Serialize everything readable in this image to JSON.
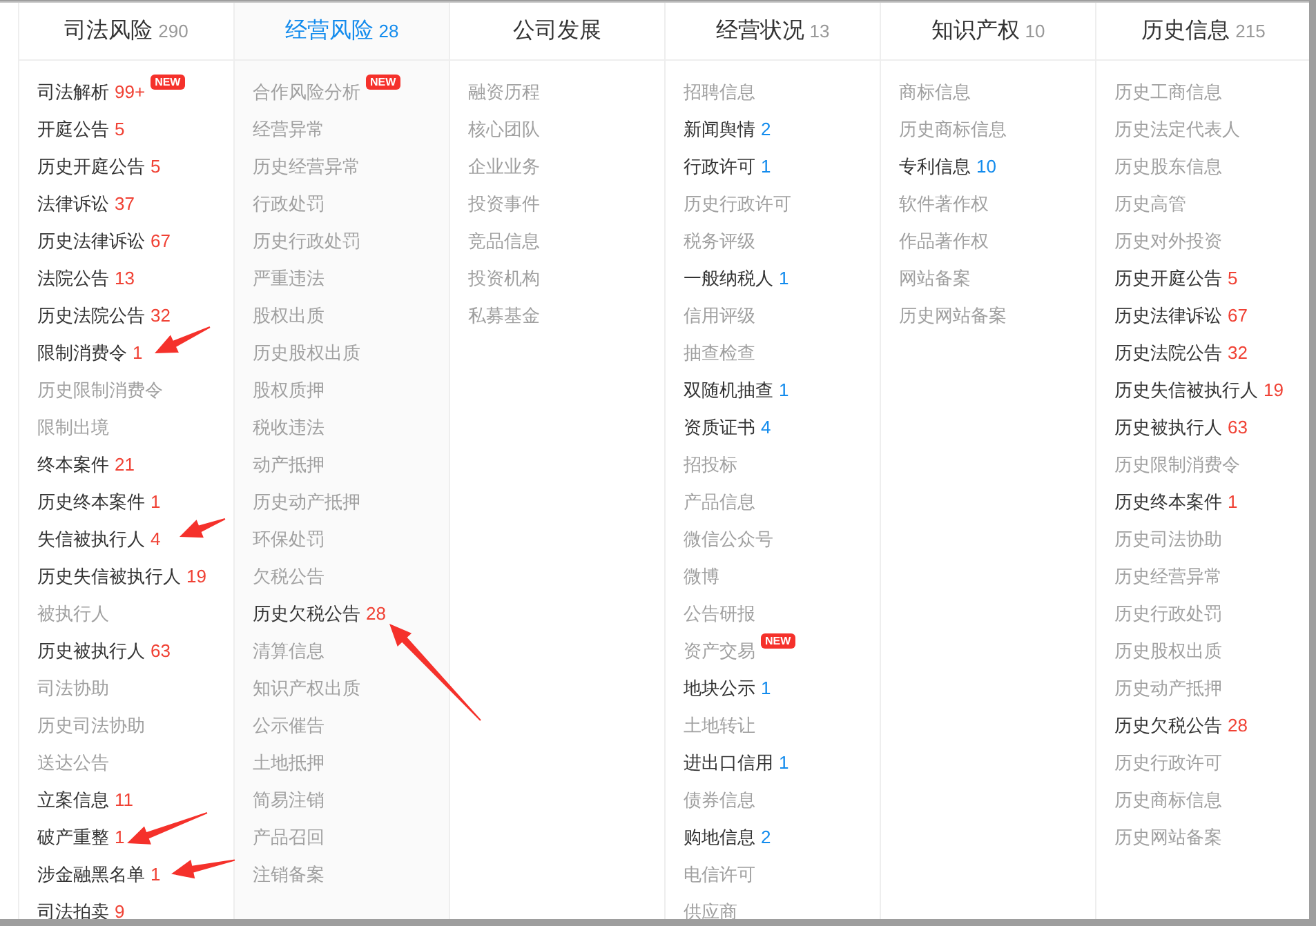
{
  "columns": [
    {
      "title": "司法风险",
      "count": "290",
      "selected": false,
      "items": [
        {
          "label": "司法解析",
          "count": "99+",
          "color": "#f04134",
          "badge": "NEW",
          "disabled": false
        },
        {
          "label": "开庭公告",
          "count": "5",
          "color": "#f04134",
          "disabled": false
        },
        {
          "label": "历史开庭公告",
          "count": "5",
          "color": "#f04134",
          "disabled": false
        },
        {
          "label": "法律诉讼",
          "count": "37",
          "color": "#f04134",
          "disabled": false
        },
        {
          "label": "历史法律诉讼",
          "count": "67",
          "color": "#f04134",
          "disabled": false
        },
        {
          "label": "法院公告",
          "count": "13",
          "color": "#f04134",
          "disabled": false
        },
        {
          "label": "历史法院公告",
          "count": "32",
          "color": "#f04134",
          "disabled": false
        },
        {
          "label": "限制消费令",
          "count": "1",
          "color": "#f04134",
          "disabled": false
        },
        {
          "label": "历史限制消费令",
          "disabled": true
        },
        {
          "label": "限制出境",
          "disabled": true
        },
        {
          "label": "终本案件",
          "count": "21",
          "color": "#f04134",
          "disabled": false
        },
        {
          "label": "历史终本案件",
          "count": "1",
          "color": "#f04134",
          "disabled": false
        },
        {
          "label": "失信被执行人",
          "count": "4",
          "color": "#f04134",
          "disabled": false
        },
        {
          "label": "历史失信被执行人",
          "count": "19",
          "color": "#f04134",
          "disabled": false
        },
        {
          "label": "被执行人",
          "disabled": true
        },
        {
          "label": "历史被执行人",
          "count": "63",
          "color": "#f04134",
          "disabled": false
        },
        {
          "label": "司法协助",
          "disabled": true
        },
        {
          "label": "历史司法协助",
          "disabled": true
        },
        {
          "label": "送达公告",
          "disabled": true
        },
        {
          "label": "立案信息",
          "count": "11",
          "color": "#f04134",
          "disabled": false
        },
        {
          "label": "破产重整",
          "count": "1",
          "color": "#f04134",
          "disabled": false
        },
        {
          "label": "涉金融黑名单",
          "count": "1",
          "color": "#f04134",
          "disabled": false
        },
        {
          "label": "司法拍卖",
          "count": "9",
          "color": "#f04134",
          "disabled": false
        }
      ]
    },
    {
      "title": "经营风险",
      "count": "28",
      "selected": true,
      "items": [
        {
          "label": "合作风险分析",
          "badge": "NEW",
          "disabled": true
        },
        {
          "label": "经营异常",
          "disabled": true
        },
        {
          "label": "历史经营异常",
          "disabled": true
        },
        {
          "label": "行政处罚",
          "disabled": true
        },
        {
          "label": "历史行政处罚",
          "disabled": true
        },
        {
          "label": "严重违法",
          "disabled": true
        },
        {
          "label": "股权出质",
          "disabled": true
        },
        {
          "label": "历史股权出质",
          "disabled": true
        },
        {
          "label": "股权质押",
          "disabled": true
        },
        {
          "label": "税收违法",
          "disabled": true
        },
        {
          "label": "动产抵押",
          "disabled": true
        },
        {
          "label": "历史动产抵押",
          "disabled": true
        },
        {
          "label": "环保处罚",
          "disabled": true
        },
        {
          "label": "欠税公告",
          "disabled": true
        },
        {
          "label": "历史欠税公告",
          "count": "28",
          "color": "#f04134",
          "disabled": false
        },
        {
          "label": "清算信息",
          "disabled": true
        },
        {
          "label": "知识产权出质",
          "disabled": true
        },
        {
          "label": "公示催告",
          "disabled": true
        },
        {
          "label": "土地抵押",
          "disabled": true
        },
        {
          "label": "简易注销",
          "disabled": true
        },
        {
          "label": "产品召回",
          "disabled": true
        },
        {
          "label": "注销备案",
          "disabled": true
        }
      ]
    },
    {
      "title": "公司发展",
      "selected": false,
      "items": [
        {
          "label": "融资历程",
          "disabled": true
        },
        {
          "label": "核心团队",
          "disabled": true
        },
        {
          "label": "企业业务",
          "disabled": true
        },
        {
          "label": "投资事件",
          "disabled": true
        },
        {
          "label": "竞品信息",
          "disabled": true
        },
        {
          "label": "投资机构",
          "disabled": true
        },
        {
          "label": "私募基金",
          "disabled": true
        }
      ]
    },
    {
      "title": "经营状况",
      "count": "13",
      "selected": false,
      "items": [
        {
          "label": "招聘信息",
          "disabled": true
        },
        {
          "label": "新闻舆情",
          "count": "2",
          "color": "#128bed",
          "disabled": false
        },
        {
          "label": "行政许可",
          "count": "1",
          "color": "#128bed",
          "disabled": false
        },
        {
          "label": "历史行政许可",
          "disabled": true
        },
        {
          "label": "税务评级",
          "disabled": true
        },
        {
          "label": "一般纳税人",
          "count": "1",
          "color": "#128bed",
          "disabled": false
        },
        {
          "label": "信用评级",
          "disabled": true
        },
        {
          "label": "抽查检查",
          "disabled": true
        },
        {
          "label": "双随机抽查",
          "count": "1",
          "color": "#128bed",
          "disabled": false
        },
        {
          "label": "资质证书",
          "count": "4",
          "color": "#128bed",
          "disabled": false
        },
        {
          "label": "招投标",
          "disabled": true
        },
        {
          "label": "产品信息",
          "disabled": true
        },
        {
          "label": "微信公众号",
          "disabled": true
        },
        {
          "label": "微博",
          "disabled": true
        },
        {
          "label": "公告研报",
          "disabled": true
        },
        {
          "label": "资产交易",
          "badge": "NEW",
          "disabled": true
        },
        {
          "label": "地块公示",
          "count": "1",
          "color": "#128bed",
          "disabled": false
        },
        {
          "label": "土地转让",
          "disabled": true
        },
        {
          "label": "进出口信用",
          "count": "1",
          "color": "#128bed",
          "disabled": false
        },
        {
          "label": "债券信息",
          "disabled": true
        },
        {
          "label": "购地信息",
          "count": "2",
          "color": "#128bed",
          "disabled": false
        },
        {
          "label": "电信许可",
          "disabled": true
        },
        {
          "label": "供应商",
          "disabled": true
        }
      ]
    },
    {
      "title": "知识产权",
      "count": "10",
      "selected": false,
      "items": [
        {
          "label": "商标信息",
          "disabled": true
        },
        {
          "label": "历史商标信息",
          "disabled": true
        },
        {
          "label": "专利信息",
          "count": "10",
          "color": "#128bed",
          "disabled": false
        },
        {
          "label": "软件著作权",
          "disabled": true
        },
        {
          "label": "作品著作权",
          "disabled": true
        },
        {
          "label": "网站备案",
          "disabled": true
        },
        {
          "label": "历史网站备案",
          "disabled": true
        }
      ]
    },
    {
      "title": "历史信息",
      "count": "215",
      "selected": false,
      "items": [
        {
          "label": "历史工商信息",
          "disabled": true
        },
        {
          "label": "历史法定代表人",
          "disabled": true
        },
        {
          "label": "历史股东信息",
          "disabled": true
        },
        {
          "label": "历史高管",
          "disabled": true
        },
        {
          "label": "历史对外投资",
          "disabled": true
        },
        {
          "label": "历史开庭公告",
          "count": "5",
          "color": "#f04134",
          "disabled": false
        },
        {
          "label": "历史法律诉讼",
          "count": "67",
          "color": "#f04134",
          "disabled": false
        },
        {
          "label": "历史法院公告",
          "count": "32",
          "color": "#f04134",
          "disabled": false
        },
        {
          "label": "历史失信被执行人",
          "count": "19",
          "color": "#f04134",
          "disabled": false
        },
        {
          "label": "历史被执行人",
          "count": "63",
          "color": "#f04134",
          "disabled": false
        },
        {
          "label": "历史限制消费令",
          "disabled": true
        },
        {
          "label": "历史终本案件",
          "count": "1",
          "color": "#f04134",
          "disabled": false
        },
        {
          "label": "历史司法协助",
          "disabled": true
        },
        {
          "label": "历史经营异常",
          "disabled": true
        },
        {
          "label": "历史行政处罚",
          "disabled": true
        },
        {
          "label": "历史股权出质",
          "disabled": true
        },
        {
          "label": "历史动产抵押",
          "disabled": true
        },
        {
          "label": "历史欠税公告",
          "count": "28",
          "color": "#f04134",
          "disabled": false
        },
        {
          "label": "历史行政许可",
          "disabled": true
        },
        {
          "label": "历史商标信息",
          "disabled": true
        },
        {
          "label": "历史网站备案",
          "disabled": true
        }
      ]
    }
  ]
}
